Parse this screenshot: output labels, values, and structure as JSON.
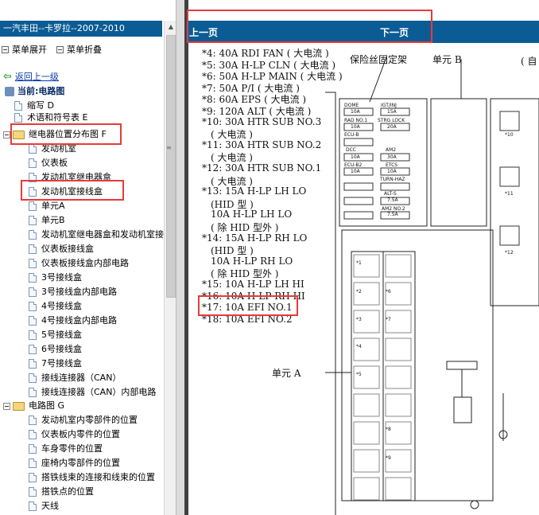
{
  "app_title": "一汽丰田--卡罗拉--2007-2010",
  "toolbar": {
    "expand": "菜单展开",
    "collapse": "菜单折叠"
  },
  "nav": {
    "back": "返回上一级",
    "current": "当前:电路图"
  },
  "tree": {
    "items_top": [
      "缩写 D",
      "术语和符号表 E"
    ],
    "folder_relay": "继电器位置分布图 F",
    "relay_children": [
      "发动机室",
      "仪表板",
      "发动机室继电器盒",
      "发动机室接线盒",
      "单元A",
      "单元B",
      "发动机室继电器盒和发动机室接",
      "仪表板接线盒",
      "仪表板接线盒内部电路",
      "3号接线盒",
      "3号接线盒内部电路",
      "4号接线盒",
      "4号接线盒内部电路",
      "5号接线盒",
      "6号接线盒",
      "7号接线盒",
      "接线连接器（CAN）",
      "接线连接器（CAN）内部电路"
    ],
    "folder_circuit": "电路图 G",
    "circuit_children": [
      "发动机室内零部件的位置",
      "仪表板内零件的位置",
      "车身零件的位置",
      "座椅内零部件的位置",
      "搭铁线束的连接和线束的位置",
      "搭铁点的位置",
      "天线"
    ]
  },
  "page_nav": {
    "prev": "上一页",
    "next": "下一页"
  },
  "fuse_list": [
    "*4: 40A RDI FAN ( 大电流 )",
    "*5: 30A H-LP CLN ( 大电流 )",
    "*6: 50A H-LP MAIN ( 大电流 )",
    "*7: 50A P/I ( 大电流 )",
    "*8: 60A EPS ( 大电流 )",
    "*9: 120A ALT ( 大电流 )",
    "*10: 30A HTR SUB NO.3",
    "( 大电流 )",
    "*11: 30A HTR SUB NO.2",
    "( 大电流 )",
    "*12: 30A HTR SUB NO.1",
    "( 大电流 )",
    "*13: 15A H-LP LH LO",
    "(HID 型 )",
    "10A H-LP LH LO",
    "( 除 HID 型外 )",
    "*14: 15A H-LP RH LO",
    "(HID 型 )",
    "10A H-LP RH LO",
    "( 除 HID 型外 )",
    "*15: 10A H-LP LH HI",
    "*16: 10A H-LP RH HI",
    "*17: 10A EFI NO.1",
    "*18: 10A EFI NO.2"
  ],
  "diagram": {
    "label_bracket": "保险丝固定架",
    "label_unit_b": "单元 B",
    "label_auto": "( 自",
    "label_unit_a": "单元 A",
    "fuse_tags": [
      "DOME",
      "IGT/INJ",
      "RAD NO.1",
      "STRG LOCK",
      "ECU-B",
      "DCC",
      "AM2",
      "ECU-B2",
      "ETCS",
      "TURN-HAZ",
      "ALT-S",
      "AM2 NO.2"
    ],
    "fuse_vals": [
      "10A",
      "15A",
      "10A",
      "20A",
      "10A",
      "30A",
      "10A",
      "10A",
      "7.5A",
      "7.5A"
    ],
    "unit_a_markers": [
      "*1",
      "*2",
      "*6",
      "*3",
      "*7",
      "*4",
      "*5",
      "*8",
      "*9"
    ],
    "unit_b_markers": [
      "*10",
      "*11",
      "*12"
    ]
  },
  "colors": {
    "titlebar": "#0b5c94",
    "highlight": "#e83a3a"
  }
}
